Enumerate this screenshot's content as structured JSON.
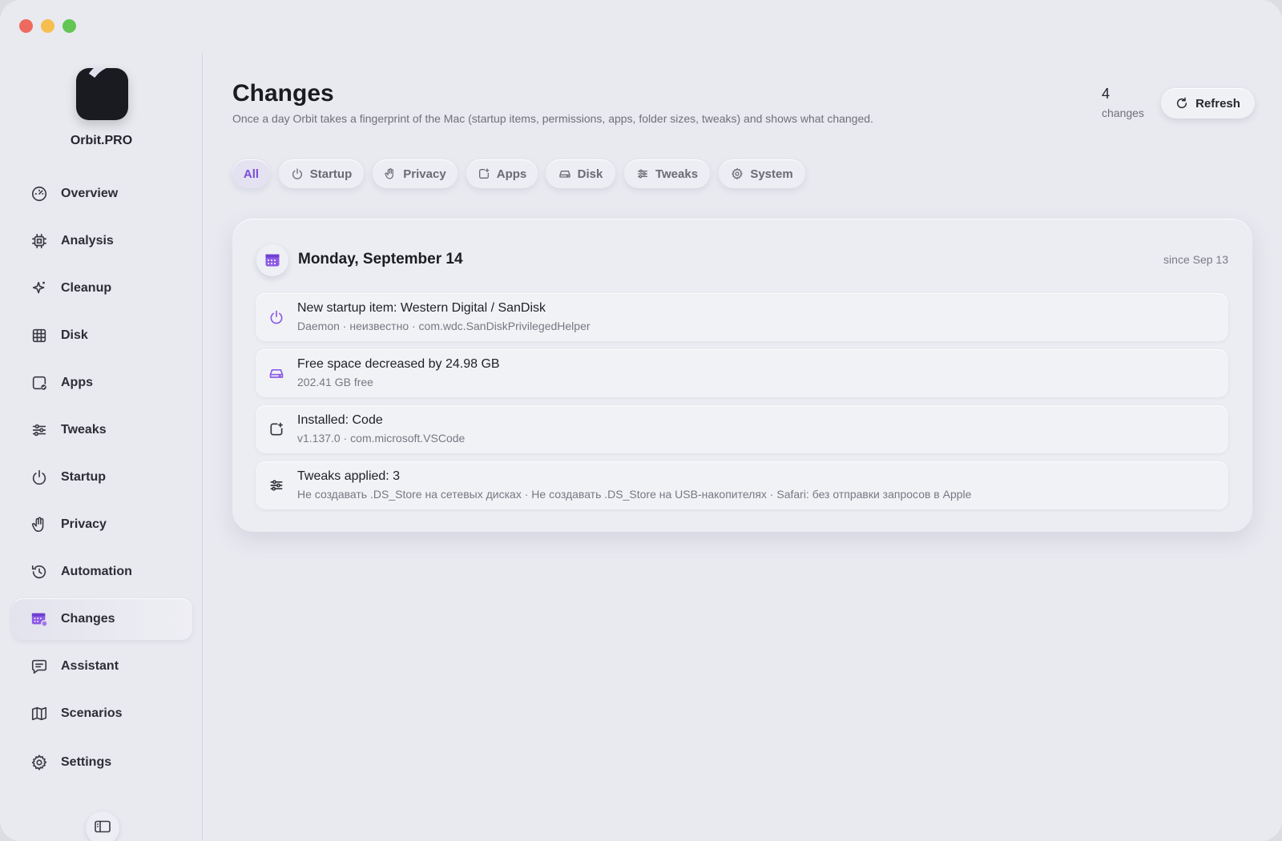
{
  "app": {
    "name": "Orbit.PRO"
  },
  "sidebar": {
    "items": [
      {
        "label": "Overview",
        "icon": "gauge-icon"
      },
      {
        "label": "Analysis",
        "icon": "cpu-icon"
      },
      {
        "label": "Cleanup",
        "icon": "sparkle-icon"
      },
      {
        "label": "Disk",
        "icon": "grid-icon"
      },
      {
        "label": "Apps",
        "icon": "app-check-icon"
      },
      {
        "label": "Tweaks",
        "icon": "sliders-icon"
      },
      {
        "label": "Startup",
        "icon": "power-icon"
      },
      {
        "label": "Privacy",
        "icon": "hand-icon"
      },
      {
        "label": "Automation",
        "icon": "history-icon"
      },
      {
        "label": "Changes",
        "icon": "calendar-icon",
        "active": true
      },
      {
        "label": "Assistant",
        "icon": "chat-icon"
      },
      {
        "label": "Scenarios",
        "icon": "map-icon"
      },
      {
        "label": "Settings",
        "icon": "gear-icon"
      }
    ]
  },
  "header": {
    "title": "Changes",
    "description": "Once a day Orbit takes a fingerprint of the Mac (startup items, permissions, apps, folder sizes, tweaks) and shows what changed.",
    "count": "4",
    "count_label": "changes",
    "refresh_label": "Refresh"
  },
  "filters": [
    {
      "label": "All",
      "active": true
    },
    {
      "label": "Startup",
      "icon": "power-icon"
    },
    {
      "label": "Privacy",
      "icon": "hand-icon"
    },
    {
      "label": "Apps",
      "icon": "app-plus-icon"
    },
    {
      "label": "Disk",
      "icon": "drive-icon"
    },
    {
      "label": "Tweaks",
      "icon": "sliders-icon"
    },
    {
      "label": "System",
      "icon": "gear-icon"
    }
  ],
  "group": {
    "date": "Monday, September 14",
    "since": "since Sep 13",
    "changes": [
      {
        "title": "New startup item: Western Digital / SanDisk",
        "subtitle": "Daemon · неизвестно · com.wdc.SanDiskPrivilegedHelper",
        "icon": "power-icon"
      },
      {
        "title": "Free space decreased by 24.98 GB",
        "subtitle": "202.41 GB free",
        "icon": "drive-icon"
      },
      {
        "title": "Installed: Code",
        "subtitle": "v1.137.0 · com.microsoft.VSCode",
        "icon": "app-plus-icon"
      },
      {
        "title": "Tweaks applied: 3",
        "subtitle": "Не создавать .DS_Store на сетевых дисках · Не создавать .DS_Store на USB-накопителях · Safari: без отправки запросов в Apple",
        "icon": "sliders-icon"
      }
    ]
  },
  "colors": {
    "accent": "#7a4fd8",
    "background": "#e9eaf0",
    "card": "#ecedf2"
  }
}
